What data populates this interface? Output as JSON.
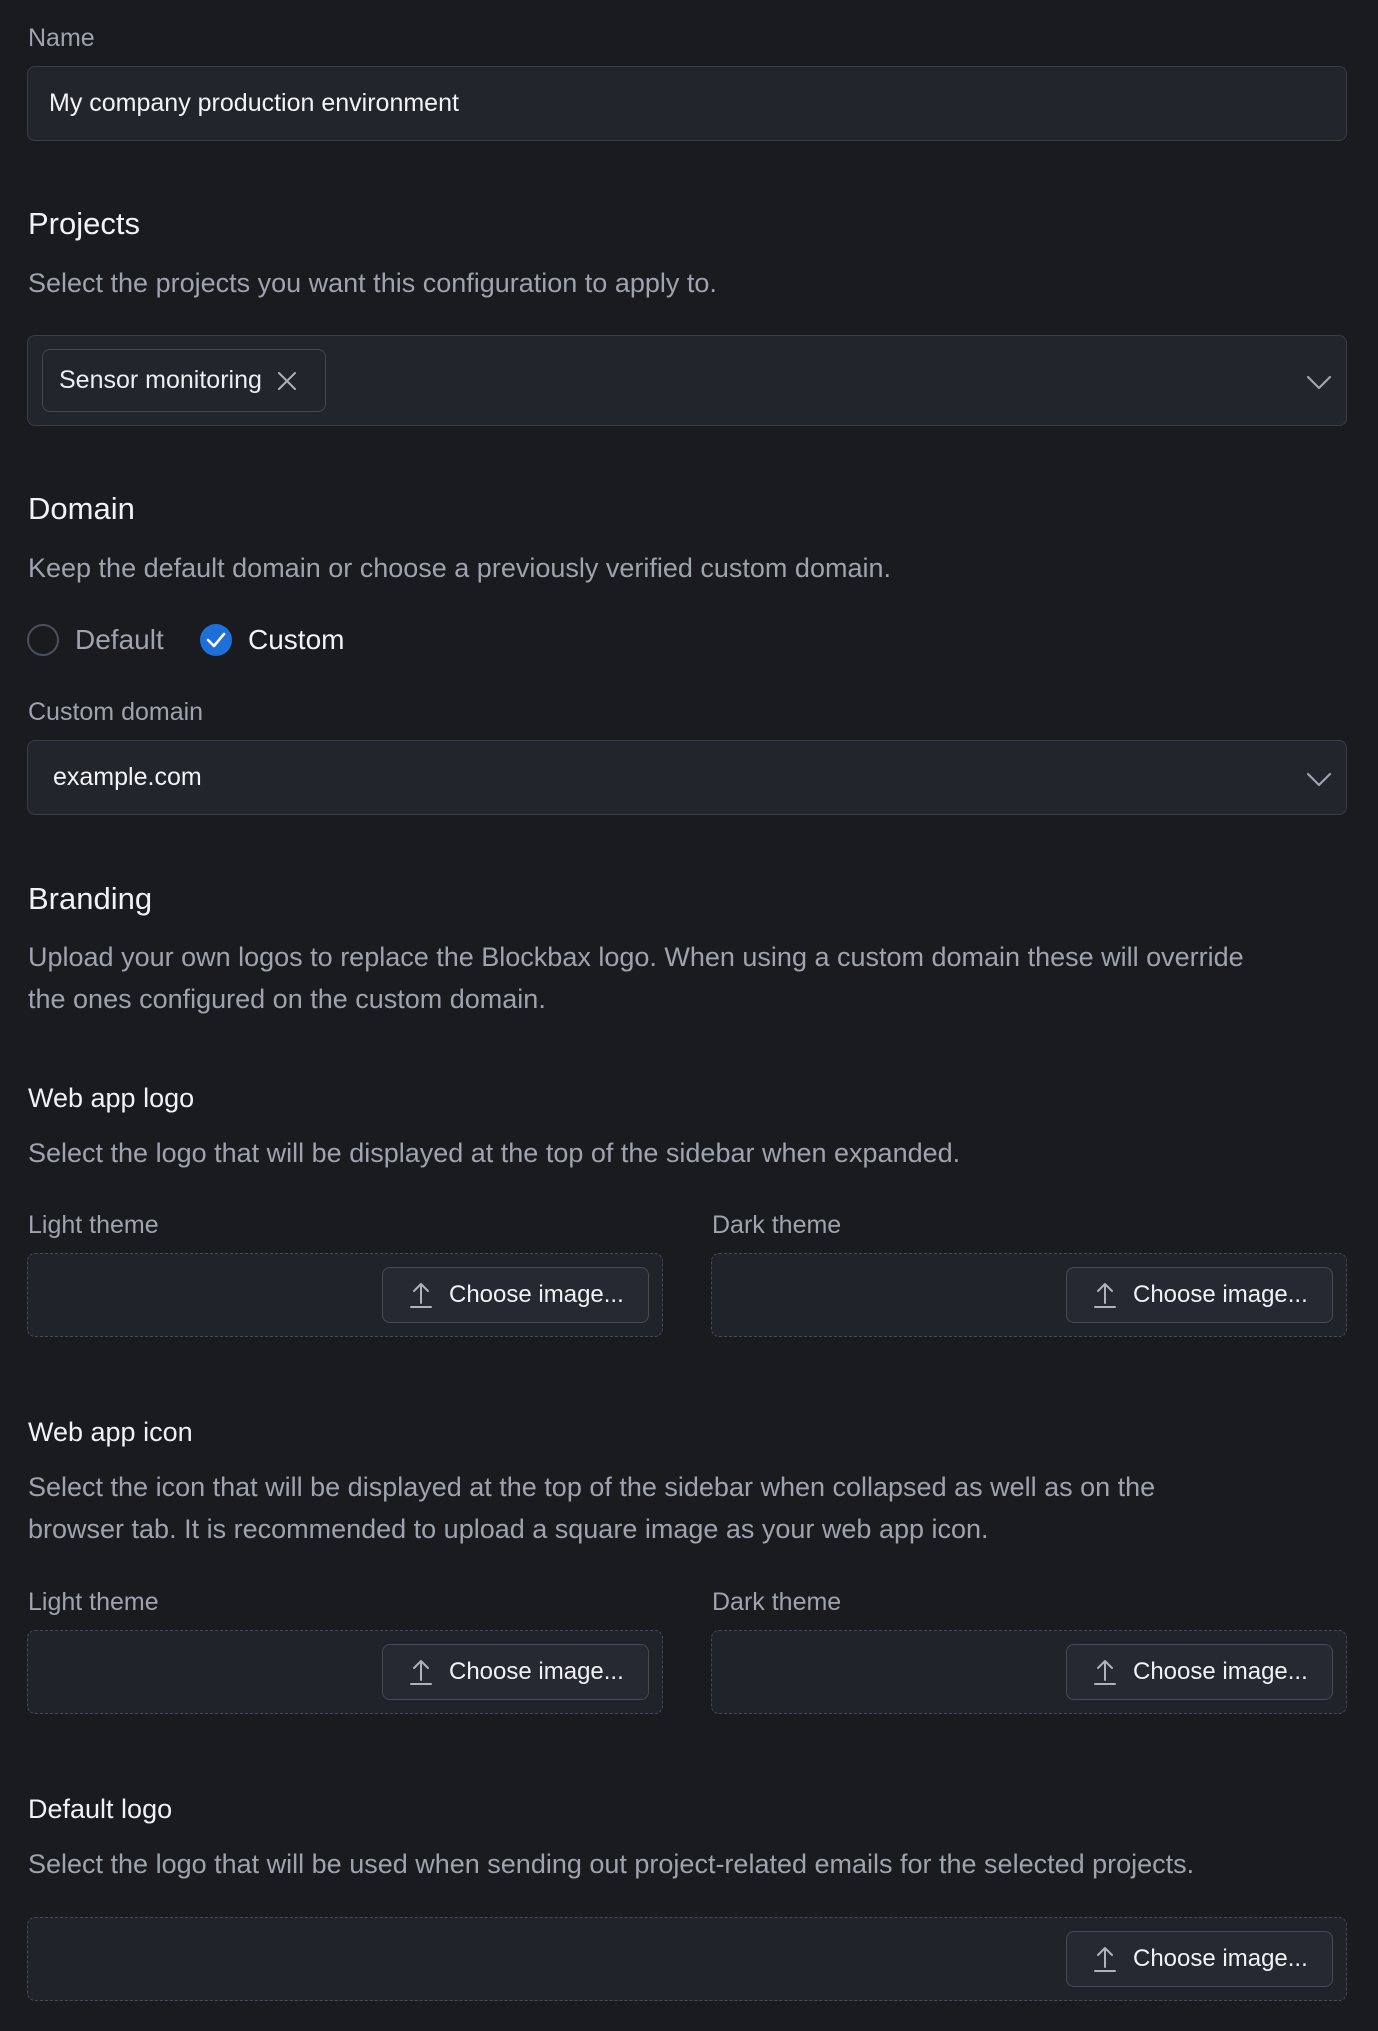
{
  "name": {
    "label": "Name",
    "value": "My company production environment"
  },
  "projects": {
    "title": "Projects",
    "description": "Select the projects you want this configuration to apply to.",
    "selected": [
      "Sensor monitoring"
    ]
  },
  "domain": {
    "title": "Domain",
    "description": "Keep the default domain or choose a previously verified custom domain.",
    "options": [
      {
        "label": "Default",
        "checked": false
      },
      {
        "label": "Custom",
        "checked": true
      }
    ],
    "custom_label": "Custom domain",
    "custom_value": "example.com"
  },
  "branding": {
    "title": "Branding",
    "description_line1": "Upload your own logos to replace the Blockbax logo. When using a custom domain these will override",
    "description_line2": "the ones configured on the custom domain.",
    "web_app_logo": {
      "title": "Web app logo",
      "description": "Select the logo that will be displayed at the top of the sidebar when expanded.",
      "light_label": "Light theme",
      "dark_label": "Dark theme"
    },
    "web_app_icon": {
      "title": "Web app icon",
      "description_line1": "Select the icon that will be displayed at the top of the sidebar when collapsed as well as on the",
      "description_line2": "browser tab. It is recommended to upload a square image as your web app icon.",
      "light_label": "Light theme",
      "dark_label": "Dark theme"
    },
    "default_logo": {
      "title": "Default logo",
      "description": "Select the logo that will be used when sending out project-related emails for the selected projects."
    },
    "choose_image_label": "Choose image..."
  },
  "colors": {
    "background": "#1a1b1f",
    "accent": "#1f6fd8"
  }
}
